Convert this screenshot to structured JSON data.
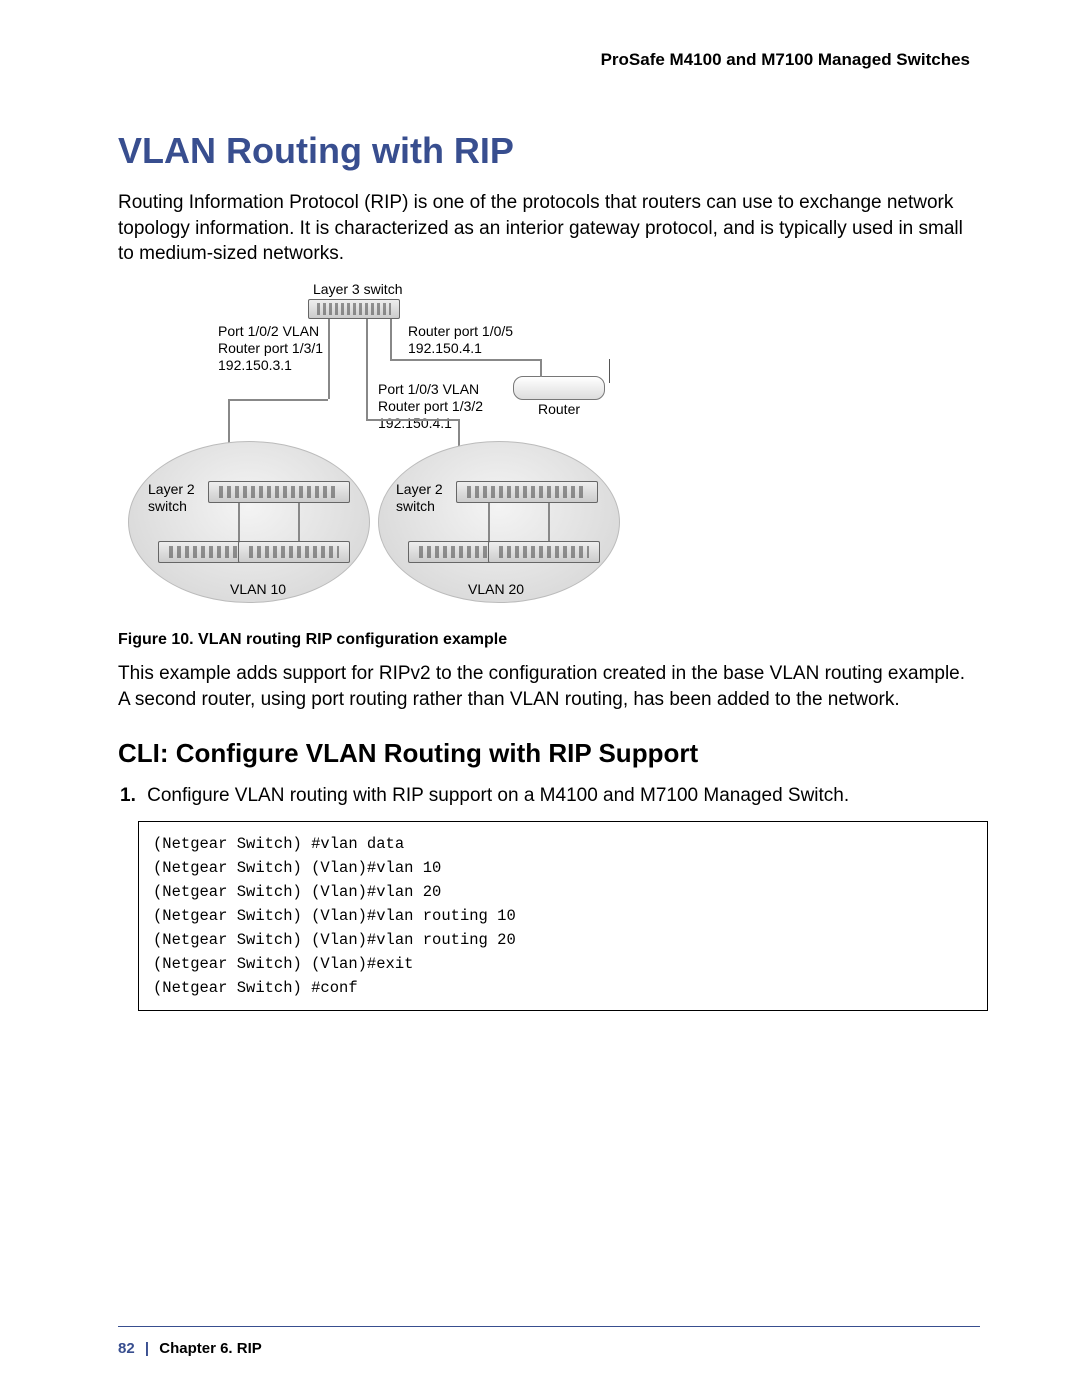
{
  "doc_header": "ProSafe M4100 and M7100 Managed Switches",
  "section_title": "VLAN Routing with RIP",
  "intro_paragraph": "Routing Information Protocol (RIP) is one of the protocols that routers can use to exchange network topology information. It is characterized as an interior gateway protocol, and is typically used in small to medium-sized networks.",
  "figure": {
    "caption": "Figure 10. VLAN routing RIP configuration example",
    "labels": {
      "l3_switch": "Layer 3 switch",
      "port_left_l1": "Port 1/0/2 VLAN",
      "port_left_l2": "Router port 1/3/1",
      "port_left_l3": "192.150.3.1",
      "router_port_l1": "Router port 1/0/5",
      "router_port_l2": "192.150.4.1",
      "port_right_l1": "Port 1/0/3 VLAN",
      "port_right_l2": "Router port 1/3/2",
      "port_right_l3": "192.150.4.1",
      "router": "Router",
      "layer2_left_l1": "Layer 2",
      "layer2_left_l2": "switch",
      "layer2_right_l1": "Layer 2",
      "layer2_right_l2": "switch",
      "vlan10": "VLAN 10",
      "vlan20": "VLAN 20"
    }
  },
  "after_figure_paragraph": "This example adds support for RIPv2 to the configuration created in the base VLAN routing example. A second router, using port routing rather than VLAN routing, has been added to the network.",
  "subsection_title": "CLI: Configure VLAN Routing with RIP Support",
  "steps": {
    "item1_num": "1.",
    "item1_text": "Configure VLAN routing with RIP support on a M4100 and M7100 Managed Switch."
  },
  "cli": {
    "l1": "(Netgear Switch) #vlan data",
    "l2": "(Netgear Switch) (Vlan)#vlan 10",
    "l3": "(Netgear Switch) (Vlan)#vlan 20",
    "l4": "(Netgear Switch) (Vlan)#vlan routing 10",
    "l5": "(Netgear Switch) (Vlan)#vlan routing 20",
    "l6": "(Netgear Switch) (Vlan)#exit",
    "l7": "(Netgear Switch) #conf"
  },
  "footer": {
    "page_number": "82",
    "separator": "|",
    "chapter": "Chapter 6.  RIP"
  }
}
